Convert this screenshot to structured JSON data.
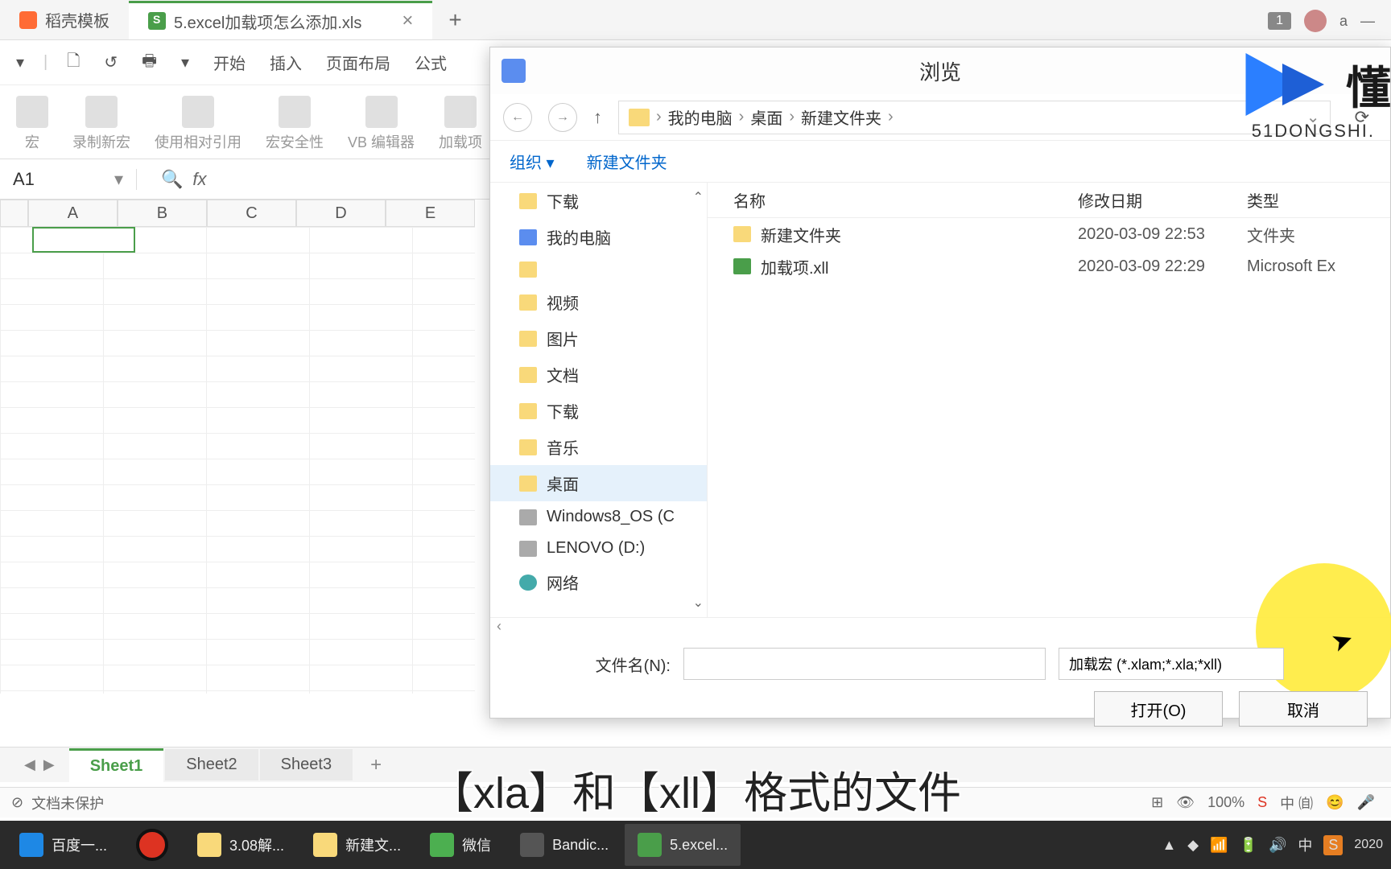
{
  "tabs": {
    "template": "稻壳模板",
    "file": "5.excel加载项怎么添加.xls"
  },
  "top_right": {
    "badge": "1",
    "user": "a",
    "min": "—"
  },
  "toolbar": {
    "items": [
      "▾",
      "|",
      "🗋",
      "↺",
      "🖶",
      "▾",
      "开始",
      "插入",
      "页面布局",
      "公式"
    ]
  },
  "ribbon": {
    "macro": "宏",
    "record": "录制新宏",
    "relative": "使用相对引用",
    "security": "宏安全性",
    "vb": "VB 编辑器",
    "addin": "加载项"
  },
  "cell_ref": "A1",
  "fx": "fx",
  "columns": [
    "A",
    "B",
    "C",
    "D",
    "E"
  ],
  "dialog": {
    "title": "浏览",
    "breadcrumb": [
      "我的电脑",
      "桌面",
      "新建文件夹"
    ],
    "organize": "组织 ▾",
    "newfolder": "新建文件夹",
    "tree": [
      {
        "label": "下载",
        "icon": "folder"
      },
      {
        "label": "我的电脑",
        "icon": "pc"
      },
      {
        "label": "",
        "icon": "folder"
      },
      {
        "label": "视频",
        "icon": "folder"
      },
      {
        "label": "图片",
        "icon": "folder"
      },
      {
        "label": "文档",
        "icon": "folder"
      },
      {
        "label": "下载",
        "icon": "folder"
      },
      {
        "label": "音乐",
        "icon": "folder"
      },
      {
        "label": "桌面",
        "icon": "folder",
        "selected": true
      },
      {
        "label": "Windows8_OS (C",
        "icon": "drive"
      },
      {
        "label": "LENOVO (D:)",
        "icon": "drive"
      },
      {
        "label": "网络",
        "icon": "net"
      }
    ],
    "list_headers": {
      "name": "名称",
      "date": "修改日期",
      "type": "类型"
    },
    "files": [
      {
        "name": "新建文件夹",
        "date": "2020-03-09 22:53",
        "type": "文件夹",
        "icon": "folder"
      },
      {
        "name": "加载项.xll",
        "date": "2020-03-09 22:29",
        "type": "Microsoft Ex",
        "icon": "xll"
      }
    ],
    "filename_label": "文件名(N):",
    "filetype": "加载宏 (*.xlam;*.xla;*xll)",
    "open_btn": "打开(O)",
    "cancel_btn": "取消"
  },
  "sheets": [
    "Sheet1",
    "Sheet2",
    "Sheet3"
  ],
  "status": {
    "protect": "文档未保护",
    "zoom": "100%"
  },
  "subtitle": "【xla】和【xll】格式的文件",
  "taskbar": {
    "items": [
      {
        "label": "百度一...",
        "color": "#1e88e5"
      },
      {
        "label": "",
        "rec": true
      },
      {
        "label": "3.08解...",
        "color": "#f9d97a"
      },
      {
        "label": "新建文...",
        "color": "#f9d97a"
      },
      {
        "label": "微信",
        "color": "#4caf50"
      },
      {
        "label": "Bandic...",
        "color": "#555"
      },
      {
        "label": "5.excel...",
        "color": "#4a9e4a",
        "active": true
      }
    ],
    "tray_lang": "中",
    "tray_time": "2020"
  },
  "watermark": {
    "text": "懂 ",
    "sub": "51DONGSHI."
  }
}
